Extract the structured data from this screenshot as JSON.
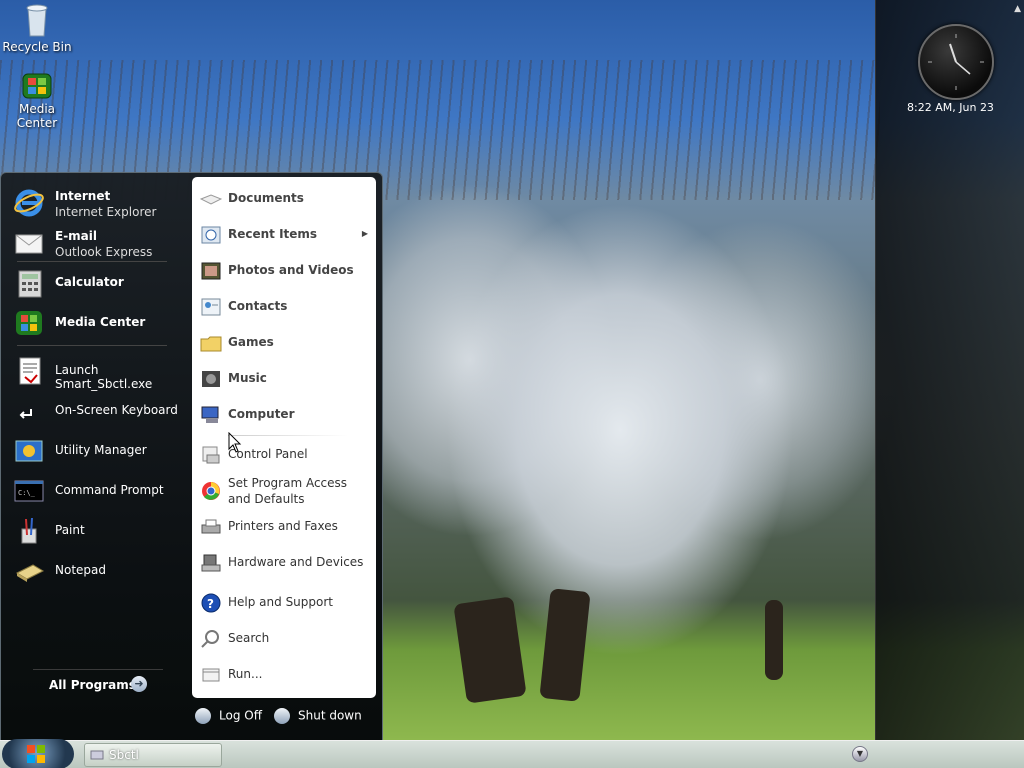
{
  "desktop": {
    "icons": [
      {
        "label": "Recycle Bin",
        "icon": "recycle-bin-icon"
      },
      {
        "label": "Media Center",
        "icon": "media-center-icon"
      }
    ]
  },
  "sidebar": {
    "clock_text": "8:22 AM, Jun 23"
  },
  "start_menu": {
    "pinned": [
      {
        "title": "Internet",
        "subtitle": "Internet Explorer",
        "icon": "internet-explorer-icon"
      },
      {
        "title": "E-mail",
        "subtitle": "Outlook Express",
        "icon": "email-icon"
      }
    ],
    "recent": [
      {
        "label": "Calculator",
        "icon": "calculator-icon",
        "bold": true
      },
      {
        "label": "Media Center",
        "icon": "media-center-icon",
        "bold": true
      },
      {
        "label": "Launch Smart_Sbctl.exe",
        "icon": "document-icon",
        "bold": false
      },
      {
        "label": "On-Screen Keyboard",
        "icon": "keyboard-icon",
        "bold": false
      },
      {
        "label": "Utility Manager",
        "icon": "utility-manager-icon",
        "bold": false
      },
      {
        "label": "Command Prompt",
        "icon": "command-prompt-icon",
        "bold": false
      },
      {
        "label": "Paint",
        "icon": "paint-icon",
        "bold": false
      },
      {
        "label": "Notepad",
        "icon": "notepad-icon",
        "bold": false
      }
    ],
    "all_programs": "All Programs",
    "right_items": [
      {
        "label": "Documents",
        "icon": "documents-icon"
      },
      {
        "label": "Recent Items",
        "icon": "recent-items-icon"
      },
      {
        "label": "Photos and Videos",
        "icon": "photos-icon"
      },
      {
        "label": "Contacts",
        "icon": "contacts-icon"
      },
      {
        "label": "Games",
        "icon": "games-icon"
      },
      {
        "label": "Music",
        "icon": "music-icon"
      },
      {
        "label": "Computer",
        "icon": "computer-icon"
      },
      {
        "label": "Control Panel",
        "icon": "control-panel-icon"
      },
      {
        "label": "Set Program Access and Defaults",
        "icon": "program-access-icon"
      },
      {
        "label": "Printers and Faxes",
        "icon": "printer-icon"
      },
      {
        "label": "Hardware and Devices",
        "icon": "hardware-icon"
      },
      {
        "label": "Help and Support",
        "icon": "help-icon"
      },
      {
        "label": "Search",
        "icon": "search-icon"
      },
      {
        "label": "Run...",
        "icon": "run-icon"
      }
    ],
    "log_off": "Log Off",
    "shut_down": "Shut down"
  },
  "taskbar": {
    "tasks": [
      {
        "label": "Sbctl",
        "icon": "app-icon"
      }
    ]
  }
}
